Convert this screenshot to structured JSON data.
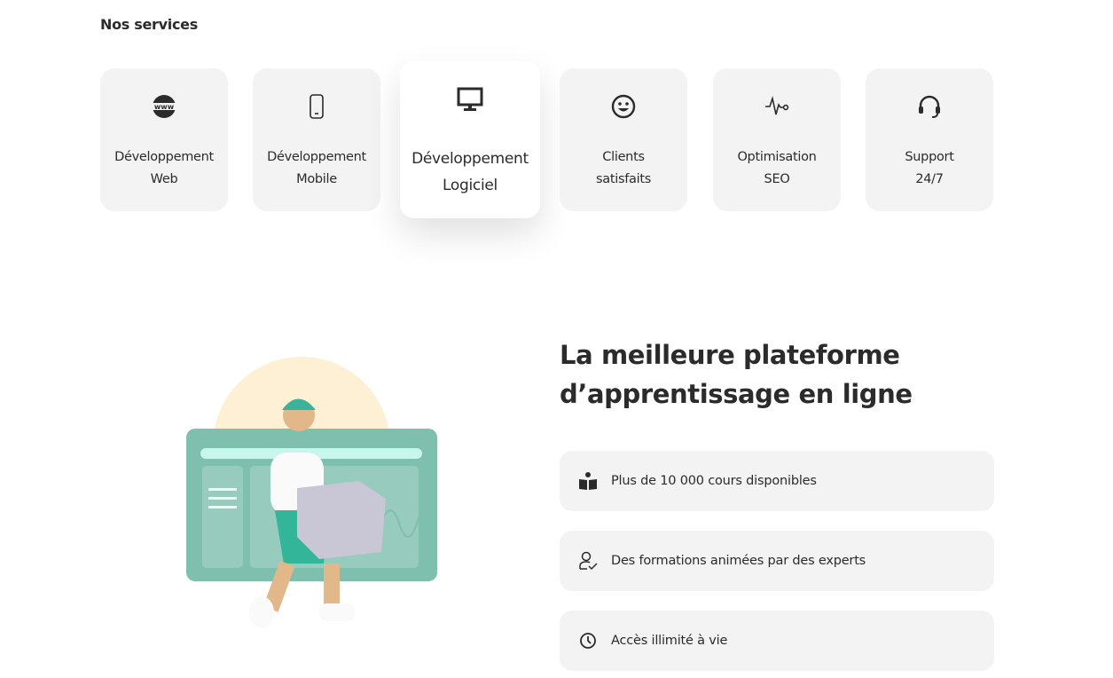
{
  "services": {
    "title": "Nos services",
    "items": [
      {
        "icon": "www-globe-icon",
        "line1": "Développement",
        "line2": "Web"
      },
      {
        "icon": "smartphone-icon",
        "line1": "Développement",
        "line2": "Mobile"
      },
      {
        "icon": "monitor-icon",
        "line1": "Développement",
        "line2": "Logiciel"
      },
      {
        "icon": "smiley-icon",
        "line1": "Clients",
        "line2": "satisfaits"
      },
      {
        "icon": "pulse-icon",
        "line1": "Optimisation",
        "line2": "SEO"
      },
      {
        "icon": "headset-icon",
        "line1": "Support",
        "line2": "24/7"
      }
    ]
  },
  "platform": {
    "heading_line1": "La meilleure plateforme",
    "heading_line2": "d’apprentissage en ligne",
    "features": [
      {
        "icon": "reader-book-icon",
        "text": "Plus de 10 000 cours disponibles"
      },
      {
        "icon": "user-check-icon",
        "text": "Des formations animées par des experts"
      },
      {
        "icon": "clock-icon",
        "text": "Accès illimité à vie"
      }
    ]
  },
  "colors": {
    "card_bg": "#f3f3f3",
    "text": "#2b2b2b",
    "illustration_green": "#7fbfae",
    "sun": "#fdf0d5"
  }
}
